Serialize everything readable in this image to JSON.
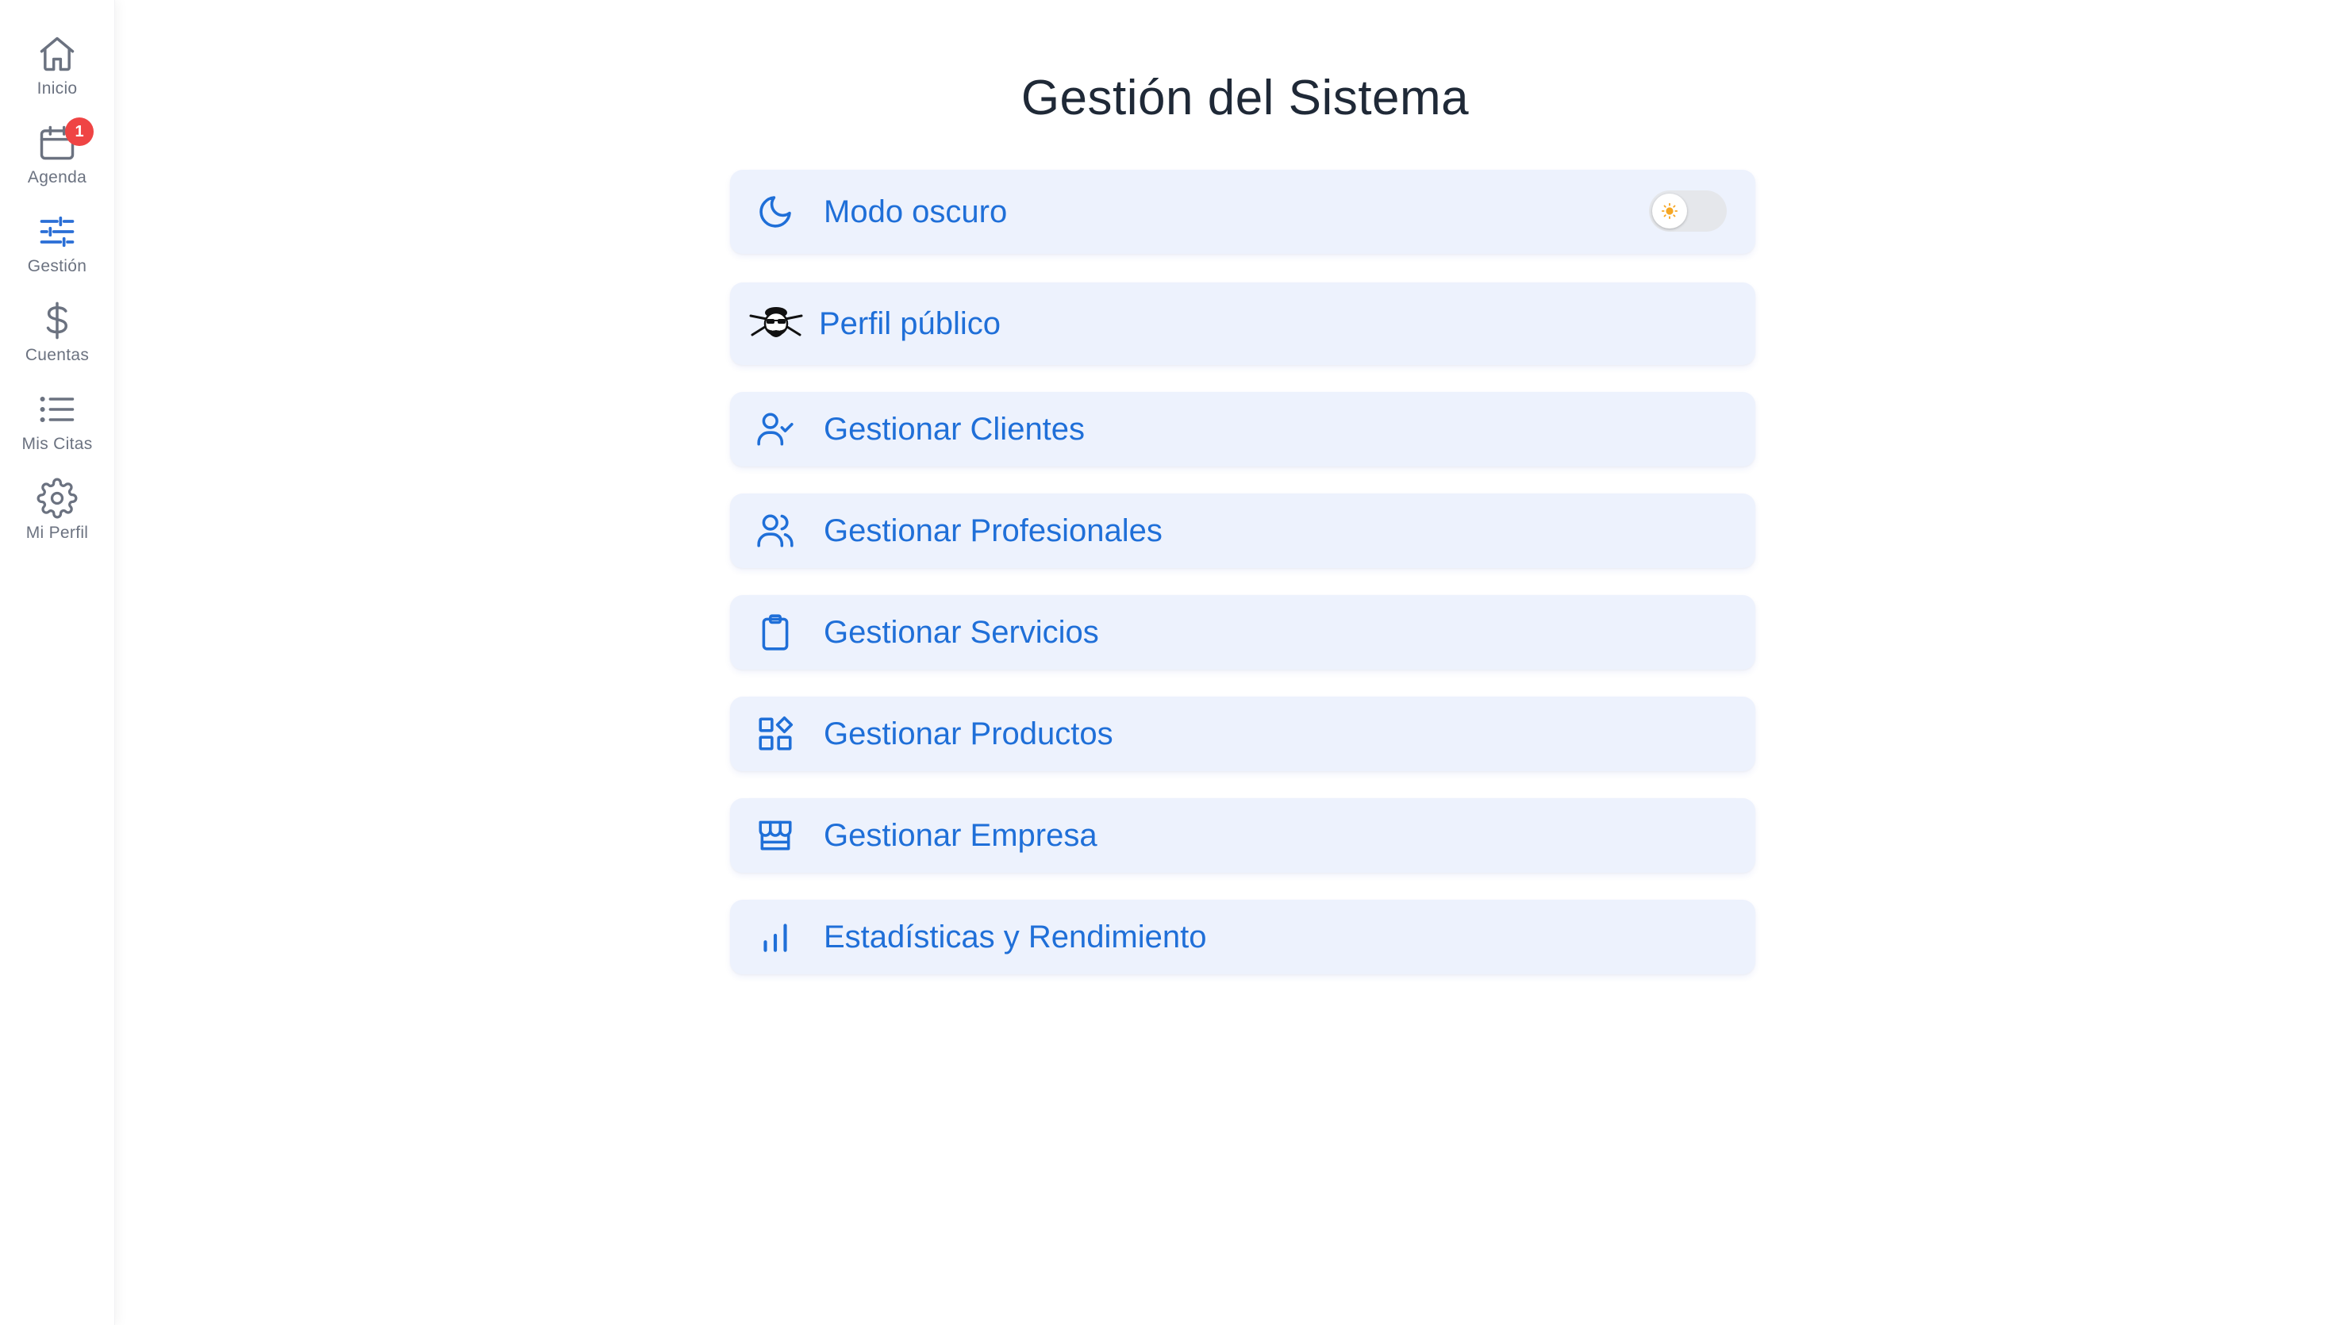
{
  "sidebar": {
    "items": [
      {
        "label": "Inicio",
        "icon": "home-icon"
      },
      {
        "label": "Agenda",
        "icon": "calendar-icon",
        "badge": "1"
      },
      {
        "label": "Gestión",
        "icon": "sliders-icon"
      },
      {
        "label": "Cuentas",
        "icon": "dollar-icon"
      },
      {
        "label": "Mis Citas",
        "icon": "list-icon"
      },
      {
        "label": "Mi Perfil",
        "icon": "gear-icon"
      }
    ],
    "active": "Gestión"
  },
  "page": {
    "title": "Gestión del Sistema"
  },
  "menu": {
    "dark_mode": {
      "label": "Modo oscuro",
      "icon": "moon-icon",
      "enabled": false
    },
    "items": [
      {
        "label": "Perfil público",
        "icon": "profile-logo-icon"
      },
      {
        "label": "Gestionar Clientes",
        "icon": "user-check-icon"
      },
      {
        "label": "Gestionar Profesionales",
        "icon": "users-icon"
      },
      {
        "label": "Gestionar Servicios",
        "icon": "clipboard-icon"
      },
      {
        "label": "Gestionar Productos",
        "icon": "grid-shapes-icon"
      },
      {
        "label": "Gestionar Empresa",
        "icon": "store-icon"
      },
      {
        "label": "Estadísticas y Rendimiento",
        "icon": "bar-chart-icon"
      }
    ]
  },
  "colors": {
    "accent": "#1f6fd8",
    "card_bg": "#edf2fd",
    "badge": "#ef4444",
    "nav_icon": "#6b7280",
    "nav_active_icon": "#2b6fd6",
    "sun": "#f5a623"
  }
}
